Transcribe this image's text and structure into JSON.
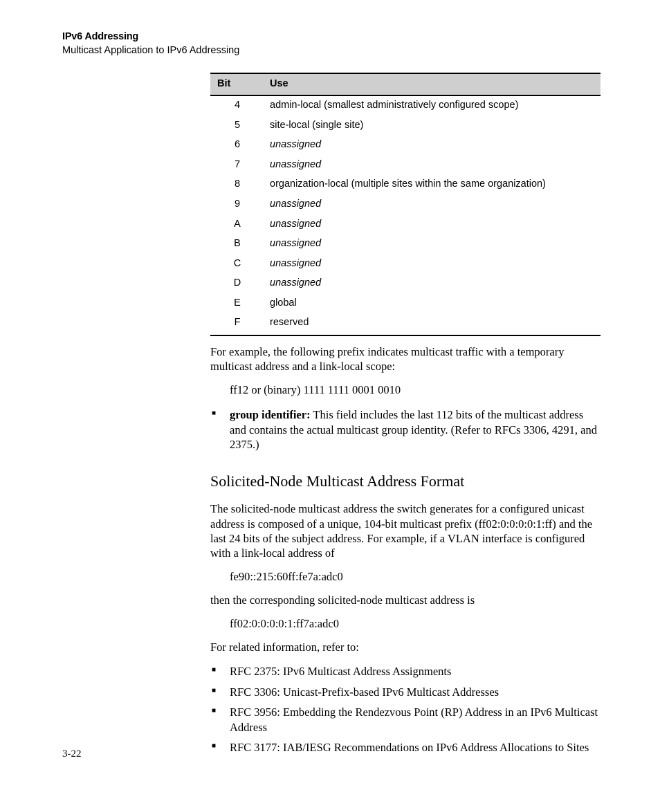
{
  "header": {
    "title": "IPv6 Addressing",
    "subtitle": "Multicast Application to IPv6 Addressing"
  },
  "table": {
    "col_bit": "Bit",
    "col_use": "Use",
    "rows": [
      {
        "bit": "4",
        "use": "admin-local (smallest administratively configured scope)",
        "italic": false
      },
      {
        "bit": "5",
        "use": "site-local (single site)",
        "italic": false
      },
      {
        "bit": "6",
        "use": "unassigned",
        "italic": true
      },
      {
        "bit": "7",
        "use": "unassigned",
        "italic": true
      },
      {
        "bit": "8",
        "use": "organization-local (multiple sites within the same organization)",
        "italic": false
      },
      {
        "bit": "9",
        "use": "unassigned",
        "italic": true
      },
      {
        "bit": "A",
        "use": "unassigned",
        "italic": true
      },
      {
        "bit": "B",
        "use": "unassigned",
        "italic": true
      },
      {
        "bit": "C",
        "use": "unassigned",
        "italic": true
      },
      {
        "bit": "D",
        "use": "unassigned",
        "italic": true
      },
      {
        "bit": "E",
        "use": "global",
        "italic": false
      },
      {
        "bit": "F",
        "use": "reserved",
        "italic": false
      }
    ]
  },
  "para_example": "For example, the following prefix indicates multicast traffic with a temporary multicast address and a link-local scope:",
  "line_ff12": "ff12 or (binary) 1111 1111 0001 0010",
  "bullet_group_label": "group identifier:",
  "bullet_group_text": " This field includes the last 112 bits of the multicast address and contains the actual multicast group identity. (Refer to RFCs 3306, 4291, and 2375.)",
  "section_heading": "Solicited-Node Multicast Address Format",
  "para_solicited": "The solicited-node multicast address the switch generates for a configured unicast address is composed of a unique, 104-bit multicast prefix (ff02:0:0:0:0:1:ff) and the last 24 bits of the subject address. For example, if a VLAN interface is configured with a link-local address of",
  "line_fe90": "fe90::215:60ff:fe7a:adc0",
  "para_then": "then the corresponding solicited-node multicast address is",
  "line_ff02": "ff02:0:0:0:0:1:ff7a:adc0",
  "para_related": "For related information, refer to:",
  "rfc_items": [
    "RFC 2375: IPv6 Multicast Address Assignments",
    "RFC 3306: Unicast-Prefix-based IPv6 Multicast Addresses",
    "RFC 3956: Embedding the Rendezvous Point (RP) Address in an IPv6 Multicast Address",
    "RFC 3177: IAB/IESG Recommendations on IPv6 Address Allocations to Sites"
  ],
  "page_number": "3-22"
}
